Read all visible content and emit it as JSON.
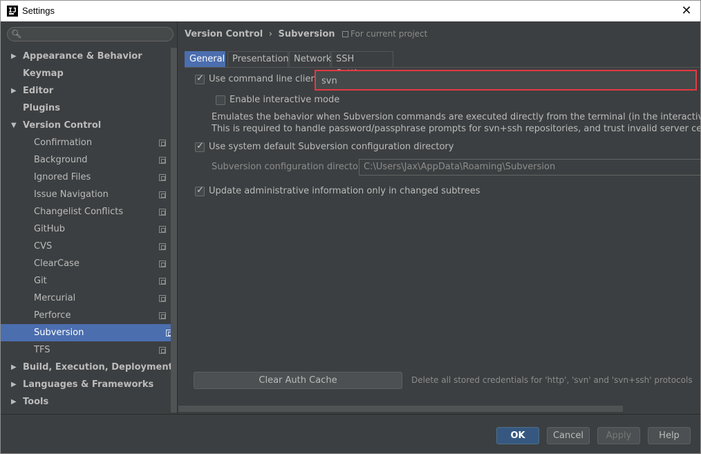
{
  "window": {
    "app_icon": "IJ",
    "title": "Settings",
    "close_icon": "close-icon"
  },
  "sidebar": {
    "search_placeholder": "",
    "items": [
      {
        "label": "Appearance & Behavior",
        "level": 0,
        "arrow": "▶"
      },
      {
        "label": "Keymap",
        "level": 0,
        "arrow": ""
      },
      {
        "label": "Editor",
        "level": 0,
        "arrow": "▶"
      },
      {
        "label": "Plugins",
        "level": 0,
        "arrow": ""
      },
      {
        "label": "Version Control",
        "level": 0,
        "arrow": "▼"
      },
      {
        "label": "Confirmation",
        "level": 1
      },
      {
        "label": "Background",
        "level": 1
      },
      {
        "label": "Ignored Files",
        "level": 1
      },
      {
        "label": "Issue Navigation",
        "level": 1
      },
      {
        "label": "Changelist Conflicts",
        "level": 1
      },
      {
        "label": "GitHub",
        "level": 1
      },
      {
        "label": "CVS",
        "level": 1
      },
      {
        "label": "ClearCase",
        "level": 1
      },
      {
        "label": "Git",
        "level": 1
      },
      {
        "label": "Mercurial",
        "level": 1
      },
      {
        "label": "Perforce",
        "level": 1
      },
      {
        "label": "Subversion",
        "level": 1,
        "selected": true
      },
      {
        "label": "TFS",
        "level": 1
      },
      {
        "label": "Build, Execution, Deployment",
        "level": 0,
        "arrow": "▶"
      },
      {
        "label": "Languages & Frameworks",
        "level": 0,
        "arrow": "▶"
      },
      {
        "label": "Tools",
        "level": 0,
        "arrow": "▶"
      }
    ]
  },
  "breadcrumb": {
    "parent": "Version Control",
    "separator": "›",
    "current": "Subversion",
    "scope": "For current project"
  },
  "tabs": [
    "General",
    "Presentation",
    "Network",
    "SSH Settings"
  ],
  "general": {
    "use_cmd_client_label": "Use command line client:",
    "use_cmd_client_checked": true,
    "cmd_client_value": "svn",
    "interactive_label": "Enable interactive mode",
    "interactive_checked": false,
    "desc_line1": "Emulates the behavior when Subversion commands are executed directly from the terminal (in the interactive mode).",
    "desc_line2": "This is required to handle password/passphrase prompts for svn+ssh repositories, and trust invalid server certificates for",
    "use_default_dir_label": "Use system default Subversion configuration directory",
    "use_default_dir_checked": true,
    "config_dir_label": "Subversion configuration directory:",
    "config_dir_value": "C:\\Users\\Jax\\AppData\\Roaming\\Subversion",
    "update_admin_label": "Update administrative information only in changed subtrees",
    "update_admin_checked": true,
    "clear_cache_label": "Clear Auth Cache",
    "clear_cache_desc": "Delete all stored credentials for 'http', 'svn' and 'svn+ssh' protocols"
  },
  "footer": {
    "ok": "OK",
    "cancel": "Cancel",
    "apply": "Apply",
    "help": "Help"
  },
  "colors": {
    "accent": "#4b6eaf",
    "highlight_box": "#e83843",
    "background": "#3c3f41"
  }
}
